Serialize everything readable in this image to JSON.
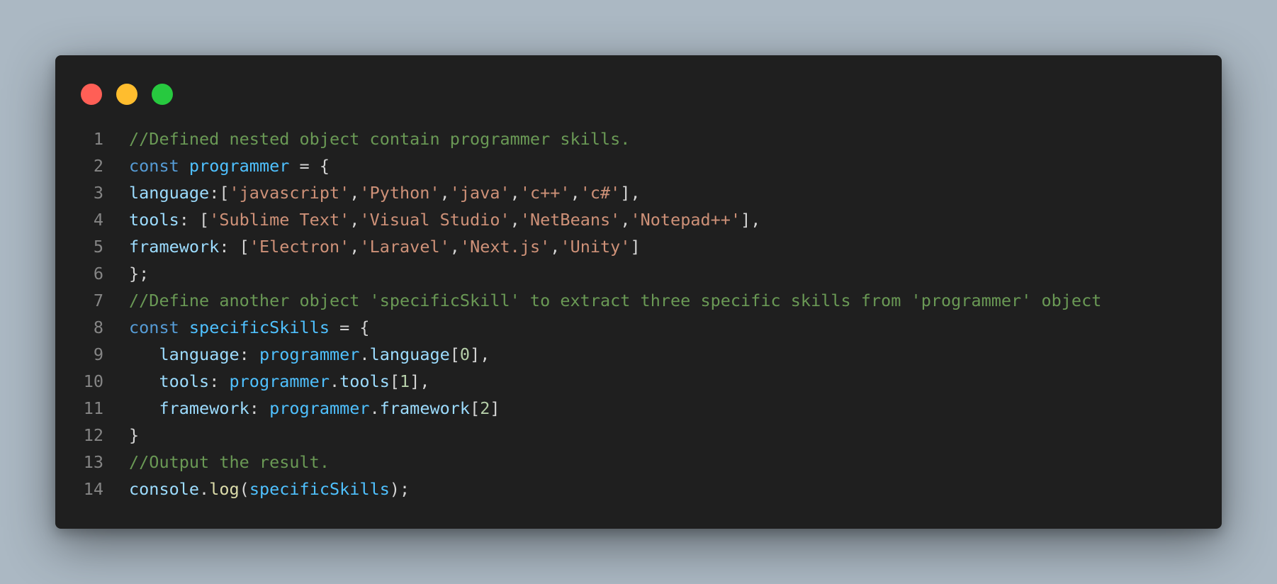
{
  "window": {
    "controls": [
      {
        "name": "close",
        "color": "#ff5f56"
      },
      {
        "name": "minimize",
        "color": "#ffbd2e"
      },
      {
        "name": "maximize",
        "color": "#27c93f"
      }
    ]
  },
  "colors": {
    "background": "#abb8c3",
    "editor": "#1f1f1f",
    "comment": "#6a9955",
    "keyword": "#569cd6",
    "variable": "#4fc1ff",
    "property": "#9cdcfe",
    "string": "#ce9178",
    "number": "#b5cea8",
    "function": "#dcdcaa",
    "plain": "#d4d4d4",
    "line_number": "#858585"
  },
  "code": {
    "lines": [
      {
        "number": "1",
        "tokens": [
          {
            "type": "comment",
            "text": "//Defined nested object contain programmer skills."
          }
        ]
      },
      {
        "number": "2",
        "tokens": [
          {
            "type": "keyword",
            "text": "const"
          },
          {
            "type": "plain",
            "text": " "
          },
          {
            "type": "variable",
            "text": "programmer"
          },
          {
            "type": "plain",
            "text": " = {"
          }
        ]
      },
      {
        "number": "3",
        "tokens": [
          {
            "type": "property",
            "text": "language"
          },
          {
            "type": "plain",
            "text": ":["
          },
          {
            "type": "string",
            "text": "'javascript'"
          },
          {
            "type": "plain",
            "text": ","
          },
          {
            "type": "string",
            "text": "'Python'"
          },
          {
            "type": "plain",
            "text": ","
          },
          {
            "type": "string",
            "text": "'java'"
          },
          {
            "type": "plain",
            "text": ","
          },
          {
            "type": "string",
            "text": "'c++'"
          },
          {
            "type": "plain",
            "text": ","
          },
          {
            "type": "string",
            "text": "'c#'"
          },
          {
            "type": "plain",
            "text": "],"
          }
        ]
      },
      {
        "number": "4",
        "tokens": [
          {
            "type": "property",
            "text": "tools"
          },
          {
            "type": "plain",
            "text": ": ["
          },
          {
            "type": "string",
            "text": "'Sublime Text'"
          },
          {
            "type": "plain",
            "text": ","
          },
          {
            "type": "string",
            "text": "'Visual Studio'"
          },
          {
            "type": "plain",
            "text": ","
          },
          {
            "type": "string",
            "text": "'NetBeans'"
          },
          {
            "type": "plain",
            "text": ","
          },
          {
            "type": "string",
            "text": "'Notepad++'"
          },
          {
            "type": "plain",
            "text": "],"
          }
        ]
      },
      {
        "number": "5",
        "tokens": [
          {
            "type": "property",
            "text": "framework"
          },
          {
            "type": "plain",
            "text": ": ["
          },
          {
            "type": "string",
            "text": "'Electron'"
          },
          {
            "type": "plain",
            "text": ","
          },
          {
            "type": "string",
            "text": "'Laravel'"
          },
          {
            "type": "plain",
            "text": ","
          },
          {
            "type": "string",
            "text": "'Next.js'"
          },
          {
            "type": "plain",
            "text": ","
          },
          {
            "type": "string",
            "text": "'Unity'"
          },
          {
            "type": "plain",
            "text": "]"
          }
        ]
      },
      {
        "number": "6",
        "tokens": [
          {
            "type": "plain",
            "text": "};"
          }
        ]
      },
      {
        "number": "7",
        "tokens": [
          {
            "type": "comment",
            "text": "//Define another object 'specificSkill' to extract three specific skills from 'programmer' object"
          }
        ]
      },
      {
        "number": "8",
        "tokens": [
          {
            "type": "keyword",
            "text": "const"
          },
          {
            "type": "plain",
            "text": " "
          },
          {
            "type": "variable",
            "text": "specificSkills"
          },
          {
            "type": "plain",
            "text": " = {"
          }
        ]
      },
      {
        "number": "9",
        "tokens": [
          {
            "type": "plain",
            "text": "   "
          },
          {
            "type": "property",
            "text": "language"
          },
          {
            "type": "plain",
            "text": ": "
          },
          {
            "type": "variable",
            "text": "programmer"
          },
          {
            "type": "plain",
            "text": "."
          },
          {
            "type": "property",
            "text": "language"
          },
          {
            "type": "plain",
            "text": "["
          },
          {
            "type": "number",
            "text": "0"
          },
          {
            "type": "plain",
            "text": "],"
          }
        ]
      },
      {
        "number": "10",
        "tokens": [
          {
            "type": "plain",
            "text": "   "
          },
          {
            "type": "property",
            "text": "tools"
          },
          {
            "type": "plain",
            "text": ": "
          },
          {
            "type": "variable",
            "text": "programmer"
          },
          {
            "type": "plain",
            "text": "."
          },
          {
            "type": "property",
            "text": "tools"
          },
          {
            "type": "plain",
            "text": "["
          },
          {
            "type": "number",
            "text": "1"
          },
          {
            "type": "plain",
            "text": "],"
          }
        ]
      },
      {
        "number": "11",
        "tokens": [
          {
            "type": "plain",
            "text": "   "
          },
          {
            "type": "property",
            "text": "framework"
          },
          {
            "type": "plain",
            "text": ": "
          },
          {
            "type": "variable",
            "text": "programmer"
          },
          {
            "type": "plain",
            "text": "."
          },
          {
            "type": "property",
            "text": "framework"
          },
          {
            "type": "plain",
            "text": "["
          },
          {
            "type": "number",
            "text": "2"
          },
          {
            "type": "plain",
            "text": "]"
          }
        ]
      },
      {
        "number": "12",
        "tokens": [
          {
            "type": "plain",
            "text": "}"
          }
        ]
      },
      {
        "number": "13",
        "tokens": [
          {
            "type": "comment",
            "text": "//Output the result."
          }
        ]
      },
      {
        "number": "14",
        "tokens": [
          {
            "type": "property",
            "text": "console"
          },
          {
            "type": "plain",
            "text": "."
          },
          {
            "type": "function",
            "text": "log"
          },
          {
            "type": "plain",
            "text": "("
          },
          {
            "type": "variable",
            "text": "specificSkills"
          },
          {
            "type": "plain",
            "text": ");"
          }
        ]
      }
    ]
  }
}
